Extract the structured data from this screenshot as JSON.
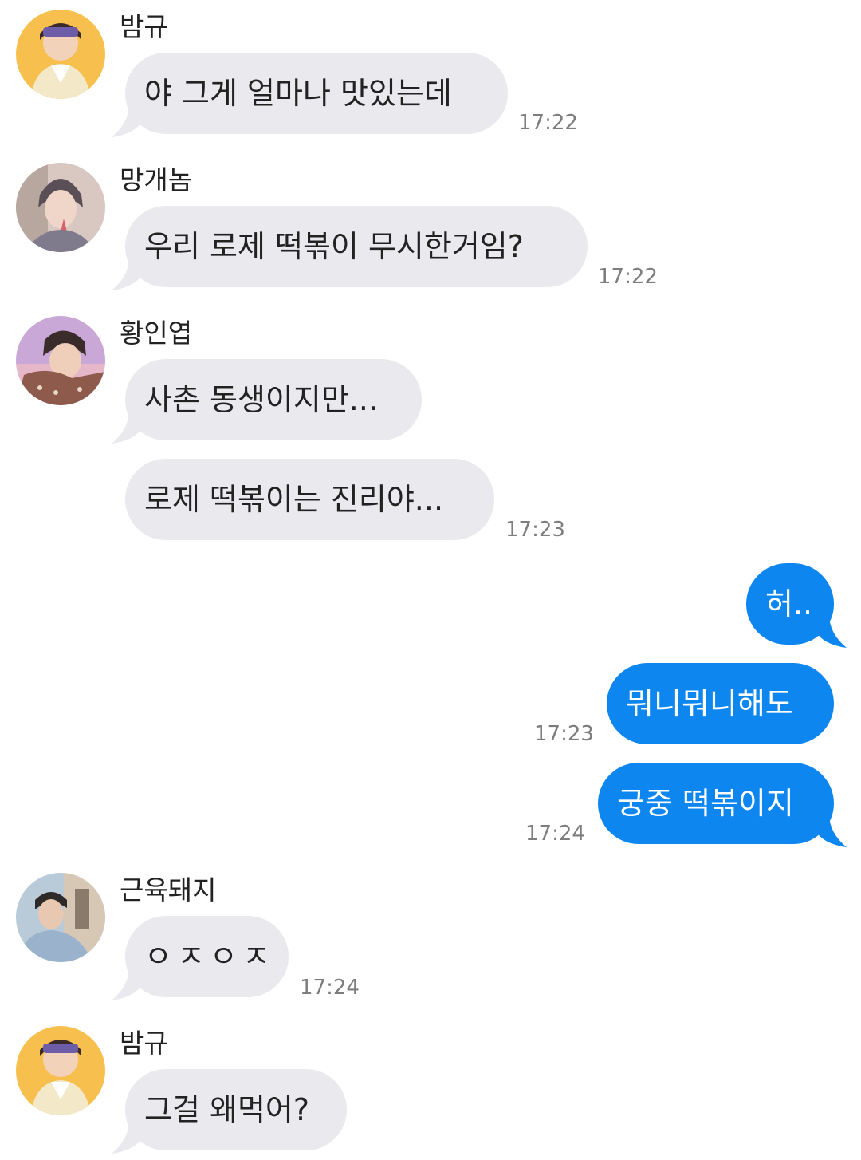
{
  "messages": [
    {
      "sender": "밤규",
      "avatar": "avatar-bamgyu",
      "text": "야 그게 얼마나 맛있는데",
      "time": "17:22"
    },
    {
      "sender": "망개놈",
      "avatar": "avatar-manggaenom",
      "text": "우리 로제 떡볶이 무시한거임?",
      "time": "17:22"
    },
    {
      "sender": "황인엽",
      "avatar": "avatar-hwanginyeop",
      "text": "사촌 동생이지만...",
      "time": ""
    },
    {
      "sender": "",
      "avatar": "",
      "text": "로제 떡볶이는 진리야...",
      "time": "17:23"
    },
    {
      "sender": "me",
      "text": "허..",
      "time": ""
    },
    {
      "sender": "me",
      "text": "뭐니뭐니해도",
      "time": "17:23"
    },
    {
      "sender": "me",
      "text": "궁중 떡볶이지",
      "time": "17:24"
    },
    {
      "sender": "근육돼지",
      "avatar": "avatar-geunyukdwaeji",
      "text": "ㅇㅈㅇㅈ",
      "time": "17:24"
    },
    {
      "sender": "밤규",
      "avatar": "avatar-bamgyu",
      "text": "그걸 왜먹어?",
      "time": ""
    }
  ],
  "colors": {
    "incoming_bubble": "#e9e9ee",
    "outgoing_bubble": "#0e86f0",
    "timestamp": "#7d7d7d"
  }
}
